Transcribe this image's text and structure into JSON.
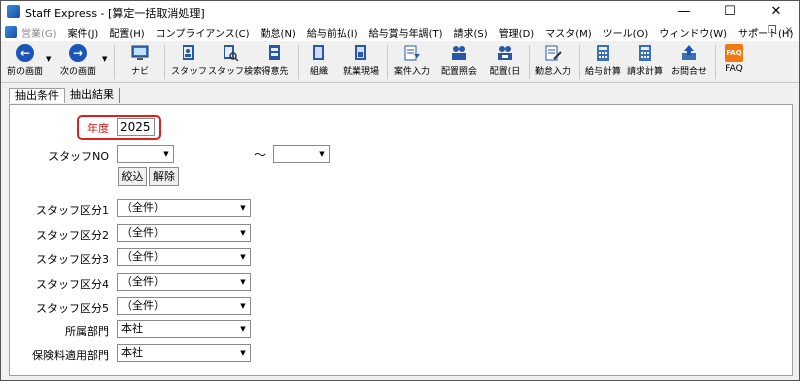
{
  "window": {
    "title": "Staff Express - [算定一括取消処理]",
    "minimize_glyph": "—",
    "maximize_glyph": "☐",
    "close_glyph": "✕"
  },
  "menu": {
    "items": [
      {
        "label": "営業(G)",
        "disabled": true
      },
      {
        "label": "案件(J)",
        "disabled": false
      },
      {
        "label": "配置(H)",
        "disabled": false
      },
      {
        "label": "コンプライアンス(C)",
        "disabled": false
      },
      {
        "label": "勤怠(N)",
        "disabled": false
      },
      {
        "label": "給与前払(I)",
        "disabled": false
      },
      {
        "label": "給与賞与年調(T)",
        "disabled": false
      },
      {
        "label": "請求(S)",
        "disabled": false
      },
      {
        "label": "管理(D)",
        "disabled": false
      },
      {
        "label": "マスタ(M)",
        "disabled": false
      },
      {
        "label": "ツール(O)",
        "disabled": false
      },
      {
        "label": "ウィンドウ(W)",
        "disabled": false
      },
      {
        "label": "サポート(H)",
        "disabled": false
      }
    ],
    "mdi_min": "−",
    "mdi_restore": "❐",
    "mdi_close": "×"
  },
  "toolbar": {
    "back_label": "前の画面",
    "forward_label": "次の画面",
    "navi_label": "ナビ",
    "staff_label": "スタッフ",
    "staff_search_label": "スタッフ検索",
    "client_label": "得意先",
    "org_label": "組織",
    "worksite_label": "就業現場",
    "job_entry_label": "案件入力",
    "placement_inquiry_label": "配置照会",
    "placement_day_label": "配置(日",
    "attendance_entry_label": "勤怠入力",
    "payroll_calc_label": "給与計算",
    "billing_calc_label": "請求計算",
    "inquiry_label": "お問合せ",
    "faq_label": "FAQ",
    "faq_icon_text": "FAQ"
  },
  "tabs": {
    "extract_conditions": "抽出条件",
    "extract_results": "抽出結果"
  },
  "form": {
    "year_label": "年度",
    "year_value": "2025",
    "staff_no_label": "スタッフNO",
    "staff_no_from": "",
    "staff_no_to": "",
    "range_tilde": "～",
    "filter_button": "絞込",
    "clear_button": "解除",
    "staff_categories": [
      {
        "label": "スタッフ区分1",
        "value": "（全件）"
      },
      {
        "label": "スタッフ区分2",
        "value": "（全件）"
      },
      {
        "label": "スタッフ区分3",
        "value": "（全件）"
      },
      {
        "label": "スタッフ区分4",
        "value": "（全件）"
      },
      {
        "label": "スタッフ区分5",
        "value": "（全件）"
      }
    ],
    "department_label": "所属部門",
    "department_value": "本社",
    "insurance_dept_label": "保険料適用部門",
    "insurance_dept_value": "本社"
  },
  "colors": {
    "highlight": "#e02020",
    "year_label": "#d11a1a",
    "nav_blue": "#1b55b8",
    "faq_orange": "#f07a10"
  }
}
